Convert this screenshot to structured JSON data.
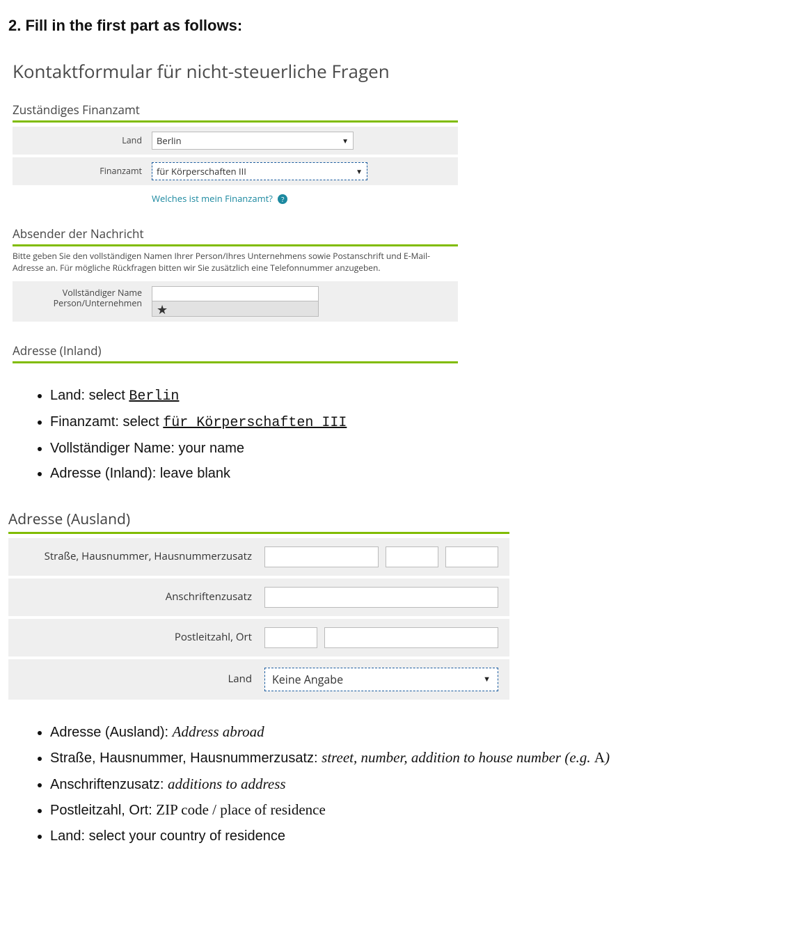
{
  "step": {
    "heading": "2. Fill in the first part as follows:"
  },
  "form1": {
    "title": "Kontaktformular für nicht-steuerliche Fragen",
    "section_finanzamt": "Zuständiges Finanzamt",
    "land_label": "Land",
    "land_value": "Berlin",
    "fa_label": "Finanzamt",
    "fa_value": "für Körperschaften III",
    "help_link": "Welches ist mein Finanzamt?",
    "section_absender": "Absender der Nachricht",
    "absender_note": "Bitte geben Sie den vollständigen Namen Ihrer Person/Ihres Unternehmens sowie Postanschrift und E-Mail-Adresse an. Für mögliche Rückfragen bitten wir Sie zusätzlich eine Telefonnummer anzugeben.",
    "name_label_line1": "Vollständiger Name",
    "name_label_line2": "Person/Unternehmen",
    "star": "★",
    "section_adresse_inland": "Adresse (Inland)"
  },
  "bullets1": {
    "b1_pre": "Land: select ",
    "b1_mono": "Berlin",
    "b2_pre": "Finanzamt: select ",
    "b2_mono": "für Körperschaften III",
    "b3": "Vollständiger Name: your name",
    "b4": "Adresse (Inland): leave blank"
  },
  "form2": {
    "section_title": "Adresse (Ausland)",
    "row1_label": "Straße,  Hausnummer, Hausnummerzusatz",
    "row2_label": "Anschriftenzusatz",
    "row3_label": "Postleitzahl,  Ort",
    "row4_label": "Land",
    "land_value": "Keine Angabe"
  },
  "bullets2": {
    "b1_pre": "Adresse (Ausland): ",
    "b1_it": "Address abroad",
    "b2_pre": "Straße, Hausnummer, Hausnummerzusatz: ",
    "b2_it": "street, number, addition to house number (e.g. ",
    "b2_roman": "A",
    "b2_it_close": ")",
    "b3_pre": "Anschriftenzusatz: ",
    "b3_it": "additions to address",
    "b4_pre": "Postleitzahl, Ort: ",
    "b4_serif": "ZIP code / place of residence",
    "b5": "Land: select your country of residence"
  }
}
